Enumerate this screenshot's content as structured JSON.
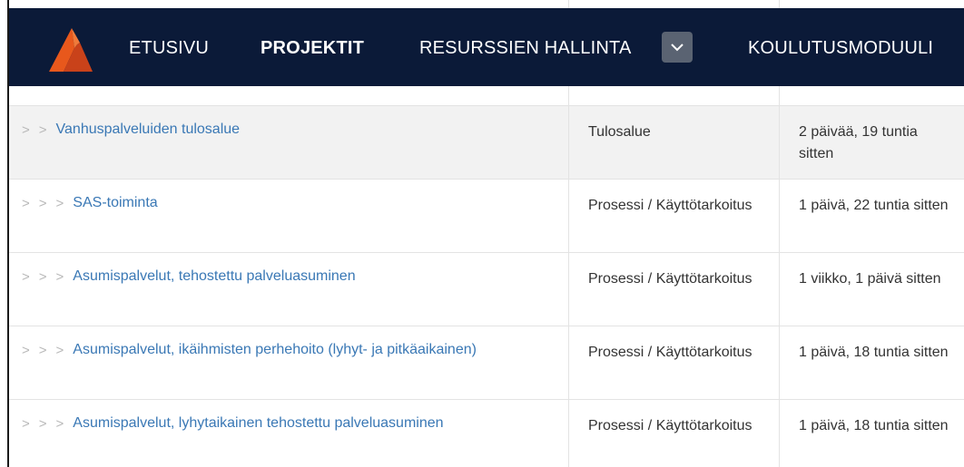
{
  "nav": {
    "items": [
      {
        "label": "ETUSIVU"
      },
      {
        "label": "PROJEKTIT"
      },
      {
        "label": "RESURSSIEN HALLINTA"
      },
      {
        "label": "KOULUTUSMODUULI"
      }
    ],
    "active": "PROJEKTIT"
  },
  "rows": [
    {
      "name": "Vanhuspalveluiden tulosalue",
      "depth": 2,
      "type": "Tulosalue",
      "time": "2 päivää, 19 tuntia sitten"
    },
    {
      "name": "SAS-toiminta",
      "depth": 3,
      "type": "Prosessi / Käyttötarkoitus",
      "time": "1 päivä, 22 tuntia sitten"
    },
    {
      "name": "Asumispalvelut, tehostettu palveluasuminen",
      "depth": 3,
      "type": "Prosessi / Käyttötarkoitus",
      "time": "1 viikko, 1 päivä sitten"
    },
    {
      "name": "Asumispalvelut, ikäihmisten perhehoito (lyhyt- ja pitkäaikainen)",
      "depth": 3,
      "type": "Prosessi / Käyttötarkoitus",
      "time": "1 päivä, 18 tuntia sitten"
    },
    {
      "name": "Asumispalvelut, lyhytaikainen tehostettu palveluasuminen",
      "depth": 3,
      "type": "Prosessi / Käyttötarkoitus",
      "time": "1 päivä, 18 tuntia sitten"
    }
  ],
  "colors": {
    "navbar": "#0b1a38",
    "link": "#3a78b5",
    "logo": "#e8581c"
  },
  "icons": {
    "logo": "brand-logo-icon",
    "dropdown": "chevron-down-icon",
    "row_expand": "chevron-right-icon"
  }
}
